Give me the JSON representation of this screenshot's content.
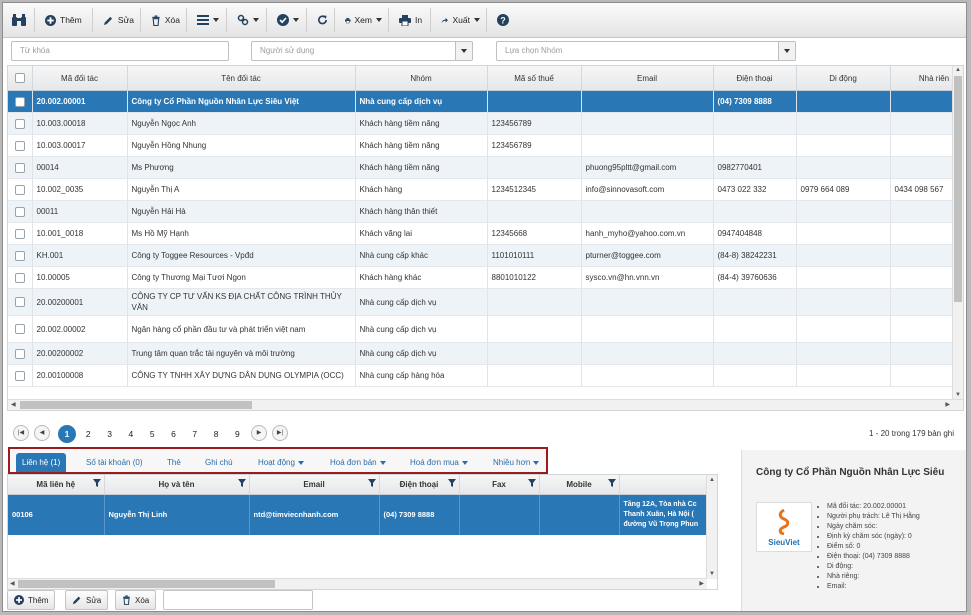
{
  "toolbar": {
    "add_label": "Thêm",
    "edit_label": "Sửa",
    "delete_label": "Xóa",
    "view_label": "Xem",
    "print_label": "In",
    "export_label": "Xuất"
  },
  "filters": {
    "keyword_placeholder": "Từ khóa",
    "user_placeholder": "Người sử dụng",
    "group_placeholder": "Lựa chọn Nhóm"
  },
  "grid": {
    "columns": [
      "Mã đối tác",
      "Tên đối tác",
      "Nhóm",
      "Mã số thuế",
      "Email",
      "Điện thoại",
      "Di động",
      "Nhà riên"
    ],
    "rows": [
      {
        "code": "20.002.00001",
        "name": "Công ty Cổ Phần Nguồn Nhân Lực Siêu Việt",
        "group": "Nhà cung cấp dịch vụ",
        "tax": "",
        "email": "",
        "phone": "(04) 7309 8888",
        "mobile": "",
        "home": ""
      },
      {
        "code": "10.003.00018",
        "name": "Nguyễn Ngọc Anh",
        "group": "Khách hàng tiềm năng",
        "tax": "123456789",
        "email": "",
        "phone": "",
        "mobile": "",
        "home": ""
      },
      {
        "code": "10.003.00017",
        "name": "Nguyễn Hồng Nhung",
        "group": "Khách hàng tiềm năng",
        "tax": "123456789",
        "email": "",
        "phone": "",
        "mobile": "",
        "home": ""
      },
      {
        "code": "00014",
        "name": "Ms Phương",
        "group": "Khách hàng tiềm năng",
        "tax": "",
        "email": "phuong95pltt@gmail.com",
        "phone": "0982770401",
        "mobile": "",
        "home": ""
      },
      {
        "code": "10.002_0035",
        "name": "Nguyễn Thị A",
        "group": "Khách hàng",
        "tax": "1234512345",
        "email": "info@sinnovasoft.com",
        "phone": "0473 022 332",
        "mobile": "0979 664 089",
        "home": "0434 098 567"
      },
      {
        "code": "00011",
        "name": "Nguyễn Hải Hà",
        "group": "Khách hàng thân thiết",
        "tax": "",
        "email": "",
        "phone": "",
        "mobile": "",
        "home": ""
      },
      {
        "code": "10.001_0018",
        "name": "Ms Hồ Mỹ Hạnh",
        "group": "Khách vãng lai",
        "tax": "12345668",
        "email": "hanh_myho@yahoo.com.vn",
        "phone": "0947404848",
        "mobile": "",
        "home": ""
      },
      {
        "code": "KH.001",
        "name": "Công ty Toggee Resources - Vpđd",
        "group": "Nhà cung cấp khác",
        "tax": "1101010111",
        "email": "pturner@toggee.com",
        "phone": "(84-8) 38242231",
        "mobile": "",
        "home": ""
      },
      {
        "code": "10.00005",
        "name": "Công ty Thương Mại Tươi Ngon",
        "group": "Khách hàng khác",
        "tax": "8801010122",
        "email": "sysco.vn@hn.vnn.vn",
        "phone": "(84-4) 39760636",
        "mobile": "",
        "home": ""
      },
      {
        "code": "20.00200001",
        "name": "CÔNG TY CP TƯ VẤN KS ĐỊA CHẤT CÔNG TRÌNH THỦY VĂN",
        "group": "Nhà cung cấp dịch vụ",
        "tax": "",
        "email": "",
        "phone": "",
        "mobile": "",
        "home": ""
      },
      {
        "code": "20.002.00002",
        "name": "Ngân hàng cổ phần đầu tư và phát triển việt nam",
        "group": "Nhà cung cấp dịch vụ",
        "tax": "",
        "email": "",
        "phone": "",
        "mobile": "",
        "home": ""
      },
      {
        "code": "20.00200002",
        "name": "Trung tâm quan trắc tài nguyên và môi trường",
        "group": "Nhà cung cấp dịch vụ",
        "tax": "",
        "email": "",
        "phone": "",
        "mobile": "",
        "home": ""
      },
      {
        "code": "20.00100008",
        "name": "CÔNG TY TNHH XÂY DỰNG DÂN DỤNG OLYMPIA (OCC)",
        "group": "Nhà cung cấp hàng hóa",
        "tax": "",
        "email": "",
        "phone": "",
        "mobile": "",
        "home": ""
      }
    ]
  },
  "pager": {
    "pages": [
      "1",
      "2",
      "3",
      "4",
      "5",
      "6",
      "7",
      "8",
      "9"
    ],
    "current": "1",
    "info": "1 - 20 trong 179 bản ghi"
  },
  "tabs": [
    {
      "label": "Liên hệ (1)",
      "dropdown": false
    },
    {
      "label": "Số tài khoản (0)",
      "dropdown": false
    },
    {
      "label": "Thẻ",
      "dropdown": false
    },
    {
      "label": "Ghi chú",
      "dropdown": false
    },
    {
      "label": "Hoạt động",
      "dropdown": true
    },
    {
      "label": "Hoá đơn bán",
      "dropdown": true
    },
    {
      "label": "Hoá đơn mua",
      "dropdown": true
    },
    {
      "label": "Nhiều hơn",
      "dropdown": true
    }
  ],
  "contacts": {
    "columns": [
      "Mã liên hệ",
      "Họ và tên",
      "Email",
      "Điện thoại",
      "Fax",
      "Mobile"
    ],
    "row": {
      "code": "00106",
      "name": "Nguyễn Thị Linh",
      "email": "ntd@timviecnhanh.com",
      "phone": "(04) 7309 8888",
      "fax": "",
      "mobile": "",
      "address_1": "Tầng 12A, Tòa nhà Cc",
      "address_2": "Thanh Xuân, Hà Nội (",
      "address_3": "đường Vũ Trọng Phun"
    }
  },
  "bottom_toolbar": {
    "add_label": "Thêm",
    "edit_label": "Sửa",
    "delete_label": "Xóa"
  },
  "detail": {
    "title": "Công ty Cổ Phần Nguồn Nhân Lực Siêu",
    "logo_text": "SieuViet",
    "info": [
      "Mã đối tác: 20.002.00001",
      "Người phụ trách: Lê Thị Hằng",
      "Ngày chăm sóc:",
      "Định kỳ chăm sóc (ngày): 0",
      "Điểm số: 0",
      "Điện thoại: (04) 7309 8888",
      "Di động:",
      "Nhà riêng:",
      "Email:"
    ]
  },
  "colors": {
    "accent": "#2a77b5",
    "highlight_border": "#9b1c1c"
  }
}
